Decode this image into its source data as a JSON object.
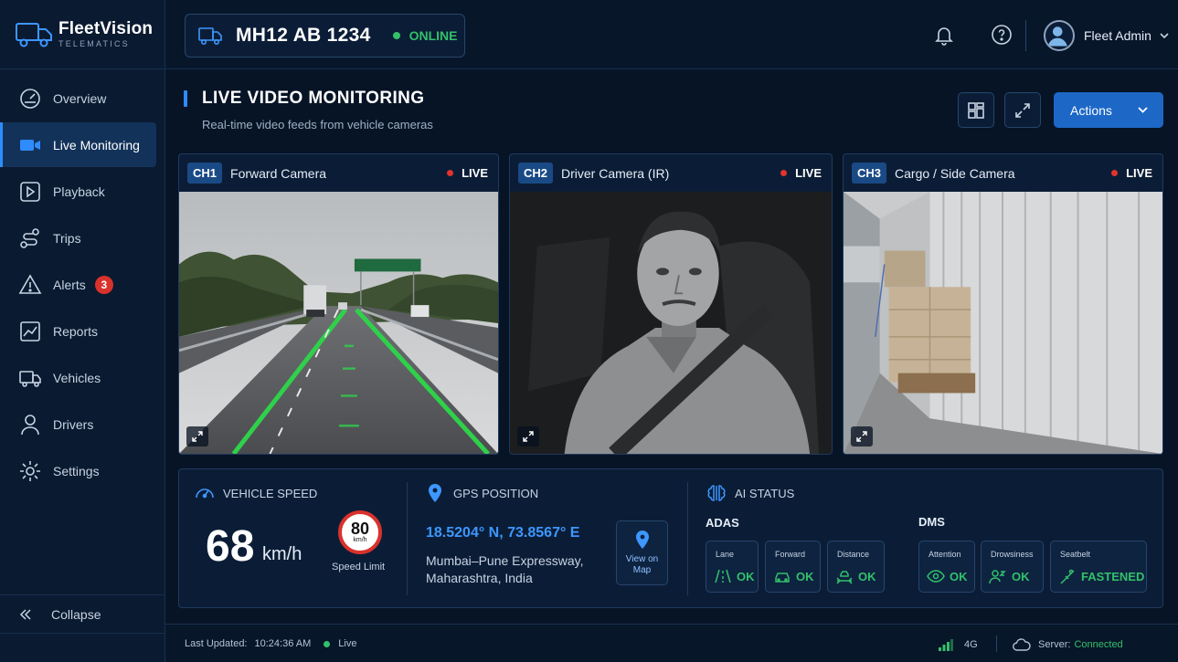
{
  "brand": {
    "name": "FleetVision",
    "subtitle": "TELEMATICS"
  },
  "sidebar": {
    "items": [
      {
        "label": "Overview",
        "icon": "gauge-icon"
      },
      {
        "label": "Live Monitoring",
        "icon": "video-camera-icon",
        "active": true
      },
      {
        "label": "Playback",
        "icon": "play-icon"
      },
      {
        "label": "Trips",
        "icon": "route-icon"
      },
      {
        "label": "Alerts",
        "icon": "warning-triangle-icon",
        "badge": "3"
      },
      {
        "label": "Reports",
        "icon": "chart-icon"
      },
      {
        "label": "Vehicles",
        "icon": "truck-icon"
      },
      {
        "label": "Drivers",
        "icon": "person-icon"
      },
      {
        "label": "Settings",
        "icon": "gear-icon"
      }
    ],
    "collapse_label": "Collapse"
  },
  "topbar": {
    "plate": "MH12 AB 1234",
    "status": "ONLINE",
    "user_name": "Fleet Admin"
  },
  "page": {
    "title": "LIVE VIDEO MONITORING",
    "subtitle": "Real-time video feeds from vehicle cameras",
    "actions_label": "Actions"
  },
  "cameras": [
    {
      "channel": "CH1",
      "name": "Forward Camera",
      "status": "LIVE"
    },
    {
      "channel": "CH2",
      "name": "Driver Camera (IR)",
      "status": "LIVE"
    },
    {
      "channel": "CH3",
      "name": "Cargo / Side Camera",
      "status": "LIVE"
    }
  ],
  "speed": {
    "title": "VEHICLE SPEED",
    "value": "68",
    "unit": "km/h",
    "limit": "80",
    "limit_unit": "km/h",
    "limit_label": "Speed Limit"
  },
  "gps": {
    "title": "GPS POSITION",
    "coords": "18.5204° N, 73.8567° E",
    "address_line1": "Mumbai–Pune Expressway,",
    "address_line2": "Maharashtra, India",
    "map_button_line1": "View on",
    "map_button_line2": "Map"
  },
  "ai": {
    "title": "AI STATUS",
    "adas_label": "ADAS",
    "dms_label": "DMS",
    "adas": [
      {
        "label": "Lane",
        "value": "OK"
      },
      {
        "label": "Forward",
        "value": "OK"
      },
      {
        "label": "Distance",
        "value": "OK"
      }
    ],
    "dms": [
      {
        "label": "Attention",
        "value": "OK"
      },
      {
        "label": "Drowsiness",
        "value": "OK"
      },
      {
        "label": "Seatbelt",
        "value": "FASTENED"
      }
    ]
  },
  "footer": {
    "last_updated_label": "Last Updated:",
    "last_updated_time": "10:24:36 AM",
    "live_label": "Live",
    "network": "4G",
    "server_label": "Server:",
    "server_status": "Connected"
  },
  "colors": {
    "accent": "#2f8cff",
    "ok_green": "#33c06a",
    "live_red": "#e2332c",
    "badge_red": "#d8322c",
    "background": "#071426"
  }
}
